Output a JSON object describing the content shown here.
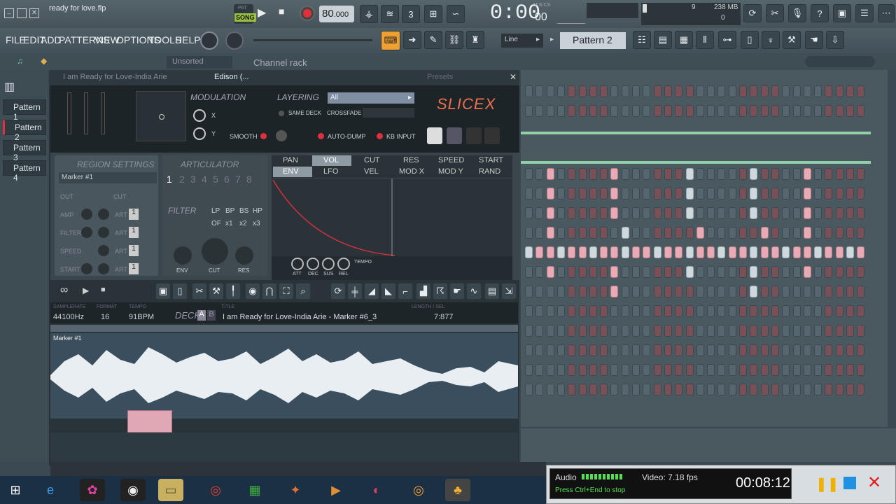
{
  "title": "ready for love.flp",
  "transport": {
    "mode": "SONG",
    "mode_top": "PAT",
    "tempo_int": "80",
    "tempo_dec": ".000",
    "time": "0:00",
    "time_sub": "00",
    "time_unit": "M:S:CS"
  },
  "monitor": {
    "cpu": "9",
    "mem": "238 MB",
    "poly": "0"
  },
  "menu": [
    "FILE",
    "EDIT",
    "ADD",
    "PATTERNS",
    "VIEW",
    "OPTIONS",
    "TOOLS",
    "HELP"
  ],
  "snap": "Line",
  "pattern_sel": "Pattern 2",
  "channel_rack": {
    "sort": "Unsorted",
    "title": "Channel rack"
  },
  "patterns": [
    "Pattern 1",
    "Pattern 2",
    "Pattern 3",
    "Pattern 4"
  ],
  "edison": {
    "title": "Edison (...",
    "window": "I am Ready for Love-India Arie",
    "presets": "Presets"
  },
  "slicex": {
    "logo": "SLICEX",
    "modulation": "MODULATION",
    "x": "X",
    "y": "Y",
    "smooth": "SMOOTH",
    "layering": "LAYERING",
    "layer_opt": "All",
    "same_deck": "SAME DECK",
    "crossfade": "CROSSFADE",
    "auto_dump": "AUTO-DUMP",
    "kb_input": "KB INPUT",
    "region": "REGION SETTINGS",
    "marker": "Marker #1",
    "out": "OUT",
    "cut": "CUT",
    "amp": "AMP",
    "art": "ART",
    "filter": "FILTER",
    "speed": "SPEED",
    "start": "START",
    "one": "1",
    "articulator": "ARTICULATOR",
    "art_nums": [
      "1",
      "2",
      "3",
      "4",
      "5",
      "6",
      "7",
      "8"
    ],
    "filt": "FILTER",
    "ftypes": [
      "LP",
      "BP",
      "BS",
      "HP"
    ],
    "fmult": [
      "OF",
      "x1",
      "x2",
      "x3"
    ],
    "env": "ENV",
    "fcut": "CUT",
    "res": "RES",
    "tabs1": [
      "PAN",
      "VOL",
      "CUT",
      "RES",
      "SPEED",
      "START"
    ],
    "tabs2": [
      "ENV",
      "LFO",
      "VEL",
      "MOD X",
      "MOD Y",
      "RAND"
    ],
    "adsr": [
      "ATT",
      "DEC",
      "SUS",
      "REL"
    ],
    "tempo": "TEMPO"
  },
  "deck": {
    "rate_lbl": "SAMPLERATE",
    "rate": "44100Hz",
    "fmt_lbl": "FORMAT",
    "fmt": "16",
    "tempo_lbl": "TEMPO",
    "bpm": "91BPM",
    "deck": "DECK",
    "a": "A",
    "b": "B",
    "title_lbl": "TITLE",
    "title": "I am Ready for Love-India Arie - Marker #6_3",
    "len_lbl": "LENGTH / SEL",
    "len": "7:877",
    "marker": "Marker #1"
  },
  "recorder": {
    "audio": "Audio",
    "video": "Video: 7.18 fps",
    "hint": "Press Ctrl+End to stop",
    "timer": "00:08:12"
  },
  "colors": {
    "accent": "#f0a030",
    "slicex_red": "#e03040",
    "step_on": "#e8aab4"
  }
}
